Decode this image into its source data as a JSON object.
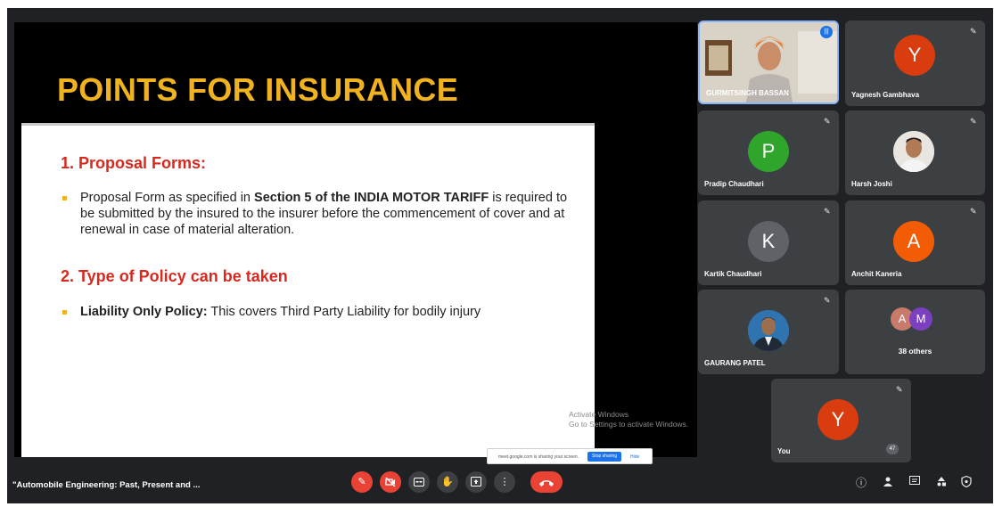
{
  "slide": {
    "title": "POINTS FOR INSURANCE",
    "heading1": "1.  Proposal Forms:",
    "bullet1_pre": "Proposal Form as specified in ",
    "bullet1_bold": "Section 5 of the INDIA MOTOR TARIFF",
    "bullet1_post": " is required to be submitted by the insured to the insurer before the commencement of cover and at  renewal in case of material alteration.",
    "heading2": "2. Type of Policy can be taken",
    "bullet2_bold": "Liability Only Policy:",
    "bullet2_post": " This covers Third Party Liability for bodily injury",
    "title_color": "#f0b21e",
    "heading_color": "#d9281e"
  },
  "watermark": {
    "line1": "Activate Windows",
    "line2": "Go to Settings to activate Windows."
  },
  "share_bar": {
    "text": "meet.google.com is sharing your screen.",
    "stop": "Stop sharing",
    "hide": "Hide"
  },
  "participants": [
    {
      "name": "GURMITSINGH BASSAN",
      "type": "video"
    },
    {
      "name": "Yagnesh Gambhava",
      "initial": "Y",
      "color": "#d93c0e"
    },
    {
      "name": "Pradip Chaudhari",
      "initial": "P",
      "color": "#2fa52b"
    },
    {
      "name": "Harsh Joshi",
      "type": "photo"
    },
    {
      "name": "Kartik Chaudhari",
      "initial": "K",
      "color": "#5f6368"
    },
    {
      "name": "Anchit Kaneria",
      "initial": "A",
      "color": "#f25c05"
    },
    {
      "name": "GAURANG PATEL",
      "type": "photo"
    },
    {
      "name": "38 others",
      "initials": [
        "A",
        "M"
      ]
    },
    {
      "name": "You",
      "initial": "Y",
      "color": "#d93c0e"
    }
  ],
  "toolbar": {
    "meeting_name": "\"Automobile Engineering: Past, Present and ...",
    "people_count": "47"
  }
}
